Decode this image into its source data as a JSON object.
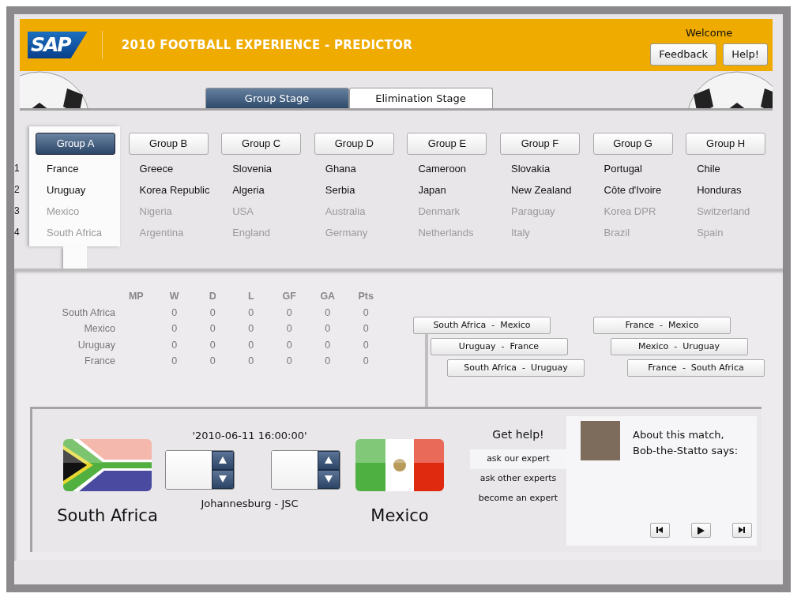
{
  "header": {
    "logo": "SAP",
    "title": "2010 FOOTBALL EXPERIENCE - PREDICTOR",
    "welcome": "Welcome",
    "buttons": [
      "Feedback",
      "Help!"
    ]
  },
  "stage_tabs": [
    {
      "label": "Group Stage",
      "selected": true
    },
    {
      "label": "Elimination Stage",
      "selected": false
    }
  ],
  "position_numbers": [
    "1",
    "2",
    "3",
    "4"
  ],
  "groups": [
    {
      "label": "Group A",
      "selected": true,
      "teams": [
        {
          "name": "France",
          "advancing": true
        },
        {
          "name": "Uruguay",
          "advancing": true
        },
        {
          "name": "Mexico",
          "advancing": false
        },
        {
          "name": "South Africa",
          "advancing": false
        }
      ]
    },
    {
      "label": "Group B",
      "selected": false,
      "teams": [
        {
          "name": "Greece",
          "advancing": true
        },
        {
          "name": "Korea Republic",
          "advancing": true
        },
        {
          "name": "Nigeria",
          "advancing": false
        },
        {
          "name": "Argentina",
          "advancing": false
        }
      ]
    },
    {
      "label": "Group C",
      "selected": false,
      "teams": [
        {
          "name": "Slovenia",
          "advancing": true
        },
        {
          "name": "Algeria",
          "advancing": true
        },
        {
          "name": "USA",
          "advancing": false
        },
        {
          "name": "England",
          "advancing": false
        }
      ]
    },
    {
      "label": "Group D",
      "selected": false,
      "teams": [
        {
          "name": "Ghana",
          "advancing": true
        },
        {
          "name": "Serbia",
          "advancing": true
        },
        {
          "name": "Australia",
          "advancing": false
        },
        {
          "name": "Germany",
          "advancing": false
        }
      ]
    },
    {
      "label": "Group E",
      "selected": false,
      "teams": [
        {
          "name": "Cameroon",
          "advancing": true
        },
        {
          "name": "Japan",
          "advancing": true
        },
        {
          "name": "Denmark",
          "advancing": false
        },
        {
          "name": "Netherlands",
          "advancing": false
        }
      ]
    },
    {
      "label": "Group F",
      "selected": false,
      "teams": [
        {
          "name": "Slovakia",
          "advancing": true
        },
        {
          "name": "New Zealand",
          "advancing": true
        },
        {
          "name": "Paraguay",
          "advancing": false
        },
        {
          "name": "Italy",
          "advancing": false
        }
      ]
    },
    {
      "label": "Group G",
      "selected": false,
      "teams": [
        {
          "name": "Portugal",
          "advancing": true
        },
        {
          "name": "Côte d'Ivoire",
          "advancing": true
        },
        {
          "name": "Korea DPR",
          "advancing": false
        },
        {
          "name": "Brazil",
          "advancing": false
        }
      ]
    },
    {
      "label": "Group H",
      "selected": false,
      "teams": [
        {
          "name": "Chile",
          "advancing": true
        },
        {
          "name": "Honduras",
          "advancing": true
        },
        {
          "name": "Switzerland",
          "advancing": false
        },
        {
          "name": "Spain",
          "advancing": false
        }
      ]
    }
  ],
  "standings": {
    "columns": [
      "MP",
      "W",
      "D",
      "L",
      "GF",
      "GA",
      "Pts"
    ],
    "rows": [
      {
        "team": "South Africa",
        "values": [
          "0",
          "0",
          "0",
          "0",
          "0",
          "0"
        ]
      },
      {
        "team": "Mexico",
        "values": [
          "0",
          "0",
          "0",
          "0",
          "0",
          "0"
        ]
      },
      {
        "team": "Uruguay",
        "values": [
          "0",
          "0",
          "0",
          "0",
          "0",
          "0"
        ]
      },
      {
        "team": "France",
        "values": [
          "0",
          "0",
          "0",
          "0",
          "0",
          "0"
        ]
      }
    ]
  },
  "fixture_columns": [
    [
      "South Africa  -  Mexico",
      "Uruguay  -  France",
      "South Africa  -  Uruguay"
    ],
    [
      "France  -  Mexico",
      "Mexico  -  Uruguay",
      "France  -  South Africa"
    ]
  ],
  "match": {
    "datetime": "'2010-06-11 16:00:00'",
    "venue": "Johannesburg - JSC",
    "teams": [
      {
        "name": "South Africa",
        "kind": "southafrica"
      },
      {
        "name": "Mexico",
        "kind": "mexico"
      }
    ]
  },
  "help": {
    "title": "Get help!",
    "items": [
      {
        "label": "ask our expert",
        "selected": true
      },
      {
        "label": "ask other experts",
        "selected": false
      },
      {
        "label": "become an expert",
        "selected": false
      }
    ]
  },
  "expert": {
    "text": "About this match,\nBob-the-Statto says:"
  }
}
